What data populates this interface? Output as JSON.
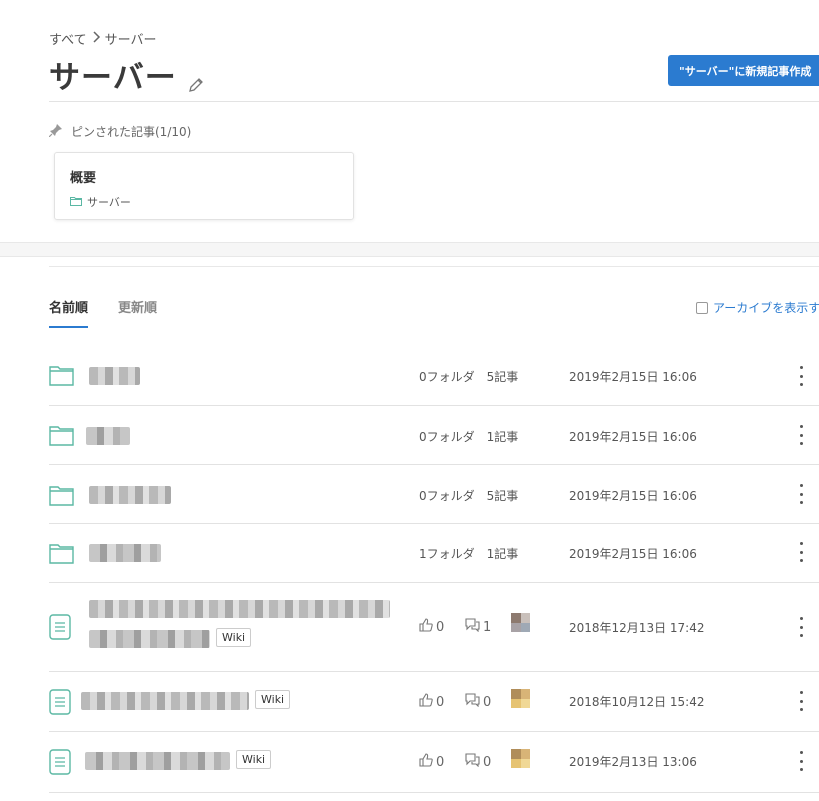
{
  "breadcrumb": {
    "root": "すべて",
    "separator": ">",
    "current": "サーバー"
  },
  "page_title": "サーバー",
  "new_article_button": "\"サーバー\"に新規記事作成",
  "pinned": {
    "label": "ピンされた記事(1/10)",
    "card": {
      "title": "概要",
      "folder": "サーバー"
    }
  },
  "tabs": [
    {
      "label": "名前順",
      "active": true
    },
    {
      "label": "更新順",
      "active": false
    }
  ],
  "archive_toggle": {
    "label": "アーカイブを表示す",
    "checked": false
  },
  "folders": [
    {
      "folders": "0フォルダ",
      "articles": "5記事",
      "date": "2019年2月15日 16:06"
    },
    {
      "folders": "0フォルダ",
      "articles": "1記事",
      "date": "2019年2月15日 16:06"
    },
    {
      "folders": "0フォルダ",
      "articles": "5記事",
      "date": "2019年2月15日 16:06"
    },
    {
      "folders": "1フォルダ",
      "articles": "1記事",
      "date": "2019年2月15日 16:06"
    }
  ],
  "articles": [
    {
      "tag": "Wiki",
      "likes": "0",
      "comments": "1",
      "date": "2018年12月13日 17:42",
      "avatar_colors": [
        "#8d7a6f",
        "#c9c0bb",
        "#a8a2a6",
        "#9fa9b5"
      ]
    },
    {
      "tag": "Wiki",
      "likes": "0",
      "comments": "0",
      "date": "2018年10月12日 15:42",
      "avatar_colors": [
        "#b08d5a",
        "#d8b477",
        "#e6c372",
        "#f0d896"
      ]
    },
    {
      "tag": "Wiki",
      "likes": "0",
      "comments": "0",
      "date": "2019年2月13日 13:06",
      "avatar_colors": [
        "#b08d5a",
        "#d8b477",
        "#e6c372",
        "#f0d896"
      ]
    }
  ],
  "colors": {
    "accent": "#2b7bd0",
    "folder_icon": "#5bb8a4"
  }
}
